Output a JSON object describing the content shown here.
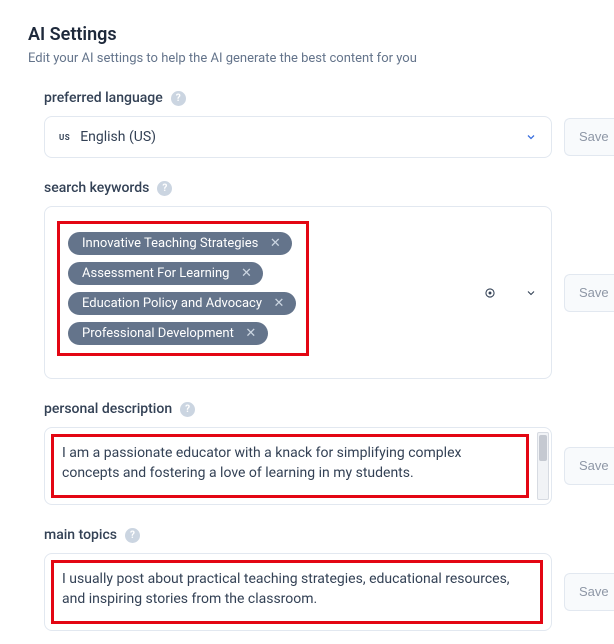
{
  "page": {
    "title": "AI Settings",
    "subtitle": "Edit your AI settings to help the AI generate the best content for you"
  },
  "buttons": {
    "save": "Save"
  },
  "language": {
    "label": "preferred language",
    "flag_code": "US",
    "value": "English (US)"
  },
  "keywords": {
    "label": "search keywords",
    "items": [
      "Innovative Teaching Strategies",
      "Assessment For Learning",
      "Education Policy and Advocacy",
      "Professional Development"
    ]
  },
  "personal": {
    "label": "personal description",
    "text": "I am a passionate educator with a knack for simplifying complex concepts and fostering a love of learning in my students."
  },
  "topics": {
    "label": "main topics",
    "text": "I usually post about practical teaching strategies, educational resources, and inspiring stories from the classroom."
  }
}
